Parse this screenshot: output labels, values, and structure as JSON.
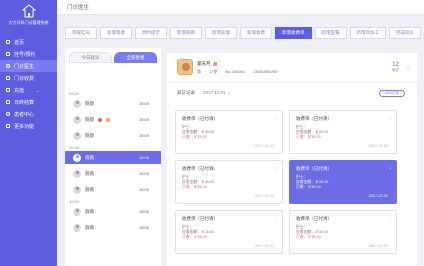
{
  "app": {
    "logo_text": "大力牙科门诊管理系统"
  },
  "sidebar": {
    "items": [
      {
        "label": "首页",
        "icon": "home-icon"
      },
      {
        "label": "挂号/预约",
        "icon": "calendar-icon"
      },
      {
        "label": "门诊医生",
        "icon": "doctor-icon",
        "active": true
      },
      {
        "label": "门诊收费",
        "icon": "cash-icon"
      },
      {
        "label": "充值",
        "icon": "wallet-icon"
      },
      {
        "label": "日终结算",
        "icon": "report-icon"
      },
      {
        "label": "患者中心",
        "icon": "user-icon"
      },
      {
        "label": "更多功能",
        "icon": "more-icon"
      }
    ]
  },
  "header": {
    "title": "门诊医生"
  },
  "tabs": [
    "等候挂号",
    "新增患者",
    "预约提示",
    "新增病例",
    "新增处理",
    "新增收费",
    "新增收费单",
    "新增医嘱",
    "新增外加工",
    "完成就诊"
  ],
  "active_tab_index": 6,
  "list": {
    "subtabs": [
      "今日就诊",
      "全部患者"
    ],
    "active_subtab": 1,
    "groups": [
      {
        "time": "09:00",
        "rows": [
          {
            "name": "薇薇",
            "time": "15:00"
          }
        ]
      },
      {
        "time": "",
        "rows": [
          {
            "name": "薇薇",
            "time": "15:00",
            "badges": true
          }
        ]
      },
      {
        "time": "",
        "rows": [
          {
            "name": "薇薇",
            "time": "15:00"
          }
        ]
      },
      {
        "time": "10:00",
        "rows": [
          {
            "name": "薇薇",
            "time": "15:00",
            "selected": true
          }
        ]
      },
      {
        "time": "",
        "rows": [
          {
            "name": "薇薇",
            "time": "15:00"
          }
        ]
      },
      {
        "time": "",
        "rows": [
          {
            "name": "薇薇",
            "time": "15:00"
          }
        ]
      },
      {
        "time": "11:00",
        "rows": [
          {
            "name": "薇薇",
            "time": "15:00"
          }
        ]
      },
      {
        "time": "",
        "rows": [
          {
            "name": "薇薇",
            "time": "15:00"
          }
        ]
      }
    ]
  },
  "patient": {
    "name": "葉夫月",
    "badge": "初",
    "gender": "男",
    "age": "17岁",
    "no": "No.100001",
    "phone": "13951956789",
    "count": "12",
    "count_label": "就诊"
  },
  "records": {
    "label": "就诊记录",
    "date": "2017-12-01 ⌄",
    "button": "ADD记录",
    "cards": [
      {
        "title": "收费单（已付清）",
        "nurse": "护士：",
        "due": "应收金额：￥35.00",
        "paid": "已收：￥35.00",
        "date": "2017-12-01"
      },
      {
        "title": "收费单（已付清）",
        "nurse": "护士：",
        "due": "应收金额：￥35.00",
        "paid": "已收：￥35.00",
        "date": "2017-12-01"
      },
      {
        "title": "收费单（已付清）",
        "nurse": "护士：",
        "due": "应收金额：￥35.00",
        "paid": "已收：￥35.00",
        "date": "2017-12-01"
      },
      {
        "title": "收费单（已付清）",
        "nurse": "护士：",
        "due": "应收金额：￥35.00",
        "paid": "已收：￥35.00",
        "date": "2017-12-01",
        "selected": true
      },
      {
        "title": "收费单（已付清）",
        "nurse": "护士：",
        "due": "应收金额：￥35.00",
        "paid": "已收：￥35.00",
        "date": "2017-12-01"
      },
      {
        "title": "收费单（已付清）",
        "nurse": "护士：",
        "due": "应收金额：￥35.00",
        "paid": "已收：￥35.00",
        "date": "2017-12-01"
      }
    ]
  }
}
